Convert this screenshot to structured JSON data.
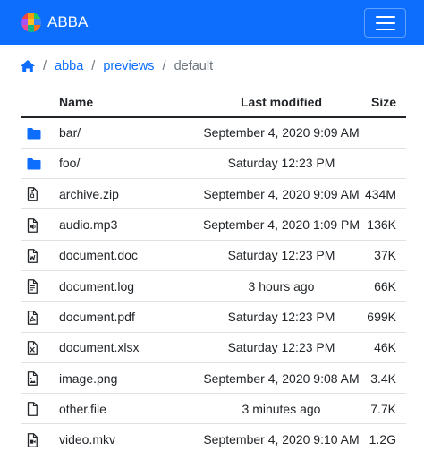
{
  "navbar": {
    "brand": "ABBA",
    "colors": {
      "background": "#0d6efd",
      "text": "#ffffff"
    }
  },
  "breadcrumb": {
    "home_icon": "home-icon",
    "items": [
      "abba",
      "previews"
    ],
    "current": "default",
    "separator": "/"
  },
  "table": {
    "headers": {
      "name": "Name",
      "modified": "Last modified",
      "size": "Size"
    },
    "rows": [
      {
        "icon": "folder-icon",
        "name": "bar/",
        "modified": "September 4, 2020 9:09 AM",
        "size": ""
      },
      {
        "icon": "folder-icon",
        "name": "foo/",
        "modified": "Saturday 12:23 PM",
        "size": ""
      },
      {
        "icon": "file-zip-icon",
        "name": "archive.zip",
        "modified": "September 4, 2020 9:09 AM",
        "size": "434M"
      },
      {
        "icon": "file-audio-icon",
        "name": "audio.mp3",
        "modified": "September 4, 2020 1:09 PM",
        "size": "136K"
      },
      {
        "icon": "file-word-icon",
        "name": "document.doc",
        "modified": "Saturday 12:23 PM",
        "size": "37K"
      },
      {
        "icon": "file-text-icon",
        "name": "document.log",
        "modified": "3 hours ago",
        "size": "66K"
      },
      {
        "icon": "file-pdf-icon",
        "name": "document.pdf",
        "modified": "Saturday 12:23 PM",
        "size": "699K"
      },
      {
        "icon": "file-excel-icon",
        "name": "document.xlsx",
        "modified": "Saturday 12:23 PM",
        "size": "46K"
      },
      {
        "icon": "file-image-icon",
        "name": "image.png",
        "modified": "September 4, 2020 9:08 AM",
        "size": "3.4K"
      },
      {
        "icon": "file-icon",
        "name": "other.file",
        "modified": "3 minutes ago",
        "size": "7.7K"
      },
      {
        "icon": "file-video-icon",
        "name": "video.mkv",
        "modified": "September 4, 2020 9:10 AM",
        "size": "1.2G"
      }
    ]
  }
}
